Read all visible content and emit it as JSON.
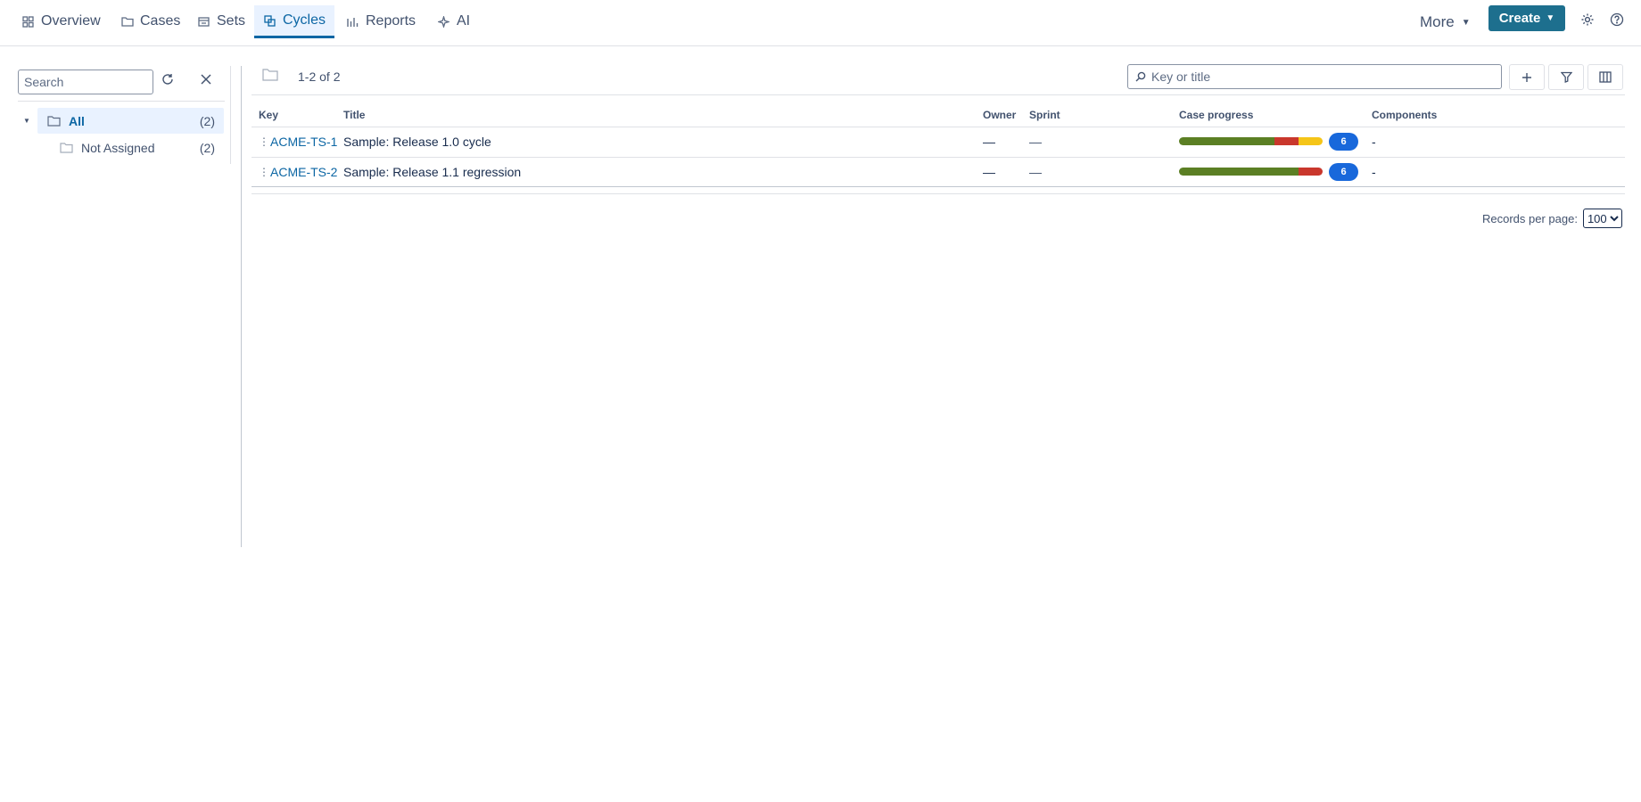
{
  "nav": {
    "tabs": [
      {
        "label": "Overview",
        "icon": "grid-icon"
      },
      {
        "label": "Cases",
        "icon": "folder-icon"
      },
      {
        "label": "Sets",
        "icon": "set-icon"
      },
      {
        "label": "Cycles",
        "icon": "cycles-icon",
        "active": true
      },
      {
        "label": "Reports",
        "icon": "bar-chart-icon"
      },
      {
        "label": "AI",
        "icon": "sparkle-icon"
      }
    ],
    "more_label": "More",
    "create_label": "Create",
    "accent_color": "#1d6f8e",
    "active_color": "#0c66a4"
  },
  "left_panel": {
    "search_placeholder": "Search",
    "tree": [
      {
        "label": "All",
        "count": "(2)",
        "selected": true
      },
      {
        "label": "Not Assigned",
        "count": "(2)"
      }
    ]
  },
  "main": {
    "count_text": "1-2 of 2",
    "key_search_placeholder": "Key or title",
    "columns": {
      "key": "Key",
      "title": "Title",
      "owner": "Owner",
      "sprint": "Sprint",
      "progress": "Case progress",
      "components": "Components"
    },
    "rows": [
      {
        "key": "ACME-TS-1",
        "title": "Sample: Release 1.0 cycle",
        "owner": "—",
        "sprint": "—",
        "progress": [
          {
            "status": "pass",
            "fraction": 0.665,
            "color": "#5b7f24"
          },
          {
            "status": "fail",
            "fraction": 0.17,
            "color": "#c9372c"
          },
          {
            "status": "in-progress",
            "fraction": 0.165,
            "color": "#f5c518"
          }
        ],
        "progress_count": "6",
        "components": "-"
      },
      {
        "key": "ACME-TS-2",
        "title": "Sample: Release 1.1 regression",
        "owner": "—",
        "sprint": "—",
        "progress": [
          {
            "status": "pass",
            "fraction": 0.835,
            "color": "#5b7f24"
          },
          {
            "status": "fail",
            "fraction": 0.165,
            "color": "#c9372c"
          }
        ],
        "progress_count": "6",
        "components": "-"
      }
    ],
    "records_per_page_label": "Records per page:",
    "records_per_page_value": "100"
  }
}
